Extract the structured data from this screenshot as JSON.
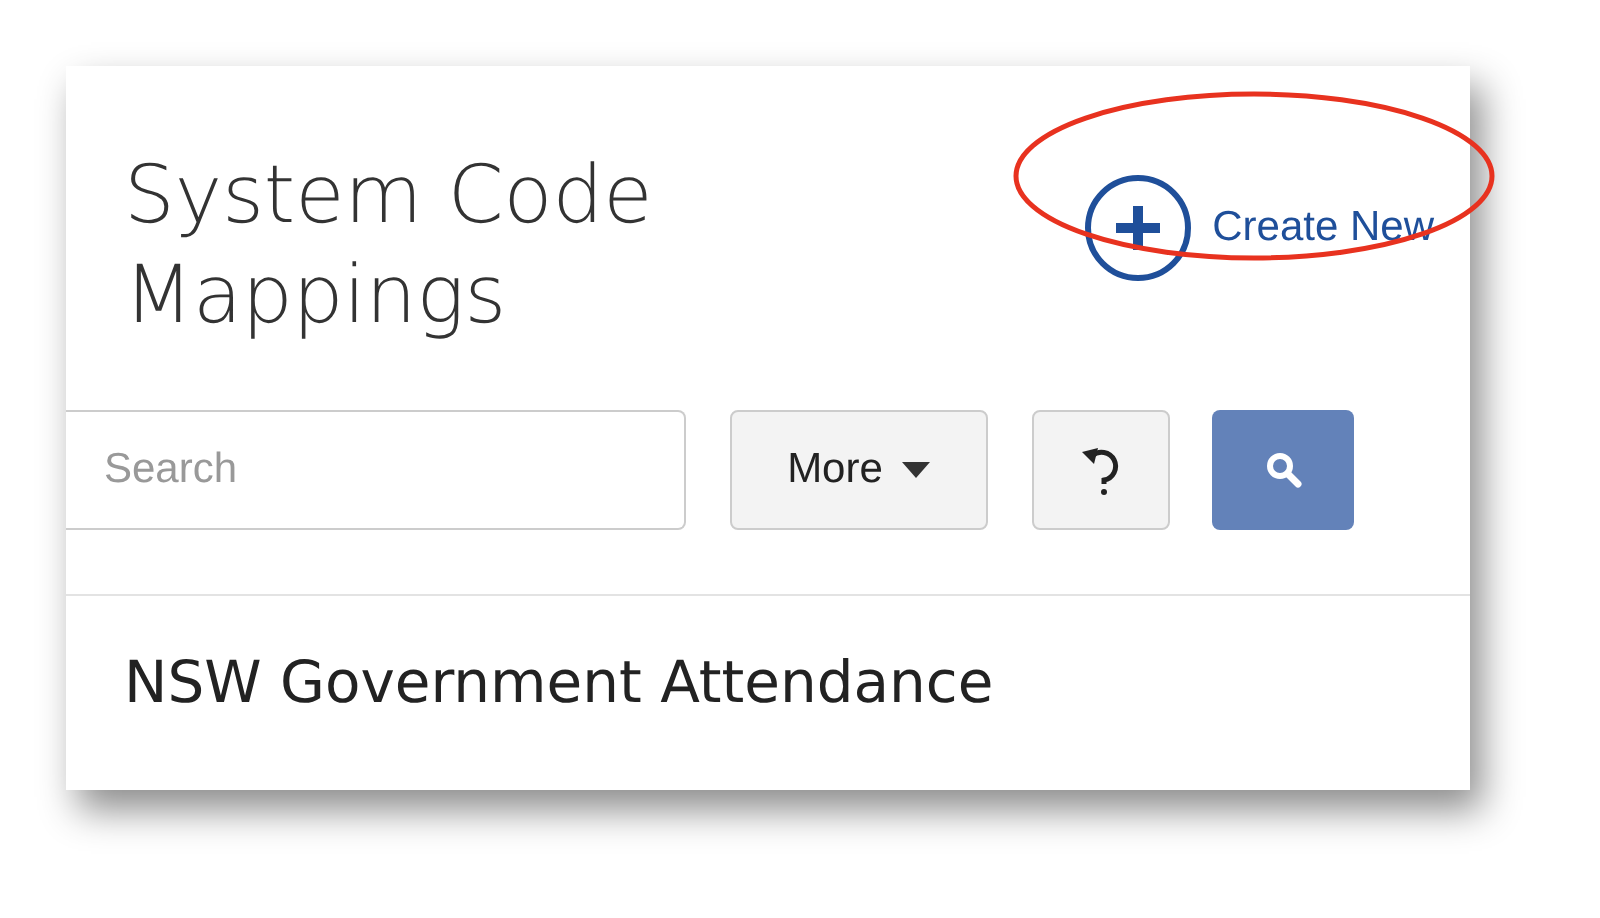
{
  "header": {
    "title": "System Code Mappings",
    "create_button": {
      "label": "Create New"
    },
    "annotation": {
      "kind": "ellipse"
    }
  },
  "toolbar": {
    "search": {
      "placeholder": "Search"
    },
    "more_button": {
      "label": "More"
    }
  },
  "rows": [
    {
      "label": "NSW Government Attendance"
    }
  ]
}
